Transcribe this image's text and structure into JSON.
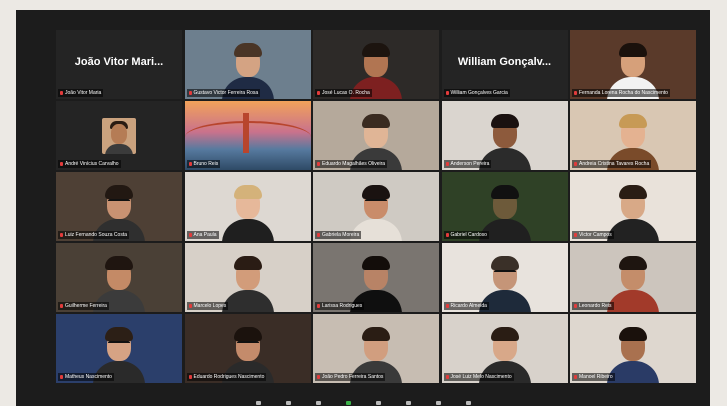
{
  "meeting": {
    "participants": [
      {
        "name": "João Vitor Maria",
        "display": "João Vitor Mari...",
        "video": false,
        "active": false
      },
      {
        "name": "Gustavo Victor Ferreira Rosa",
        "video": true,
        "active": true,
        "bg": "#6d7f8e",
        "skin": "#d4a383",
        "hair": "#4a3526",
        "shirt": "#1f2b44"
      },
      {
        "name": "José Lucas O. Rocha",
        "video": true,
        "bg": "#2d2a28",
        "skin": "#b17552",
        "hair": "#1c140f",
        "shirt": "#7d2020"
      },
      {
        "name": "William Gonçalves Garcia",
        "display": "William Gonçalv...",
        "video": false
      },
      {
        "name": "Fernanda Lorena Rocha do Nascimento",
        "video": true,
        "bg": "#5a3a2a",
        "skin": "#d6a07a",
        "hair": "#1a110c",
        "shirt": "#f2f2f2"
      },
      {
        "name": "André Vinícius Carvalho",
        "video": false,
        "avatar": true
      },
      {
        "name": "Bruno Reis",
        "video": true,
        "scenery": "bridge"
      },
      {
        "name": "Eduardo Magalhães Oliveira",
        "video": true,
        "bg": "#b5a99b",
        "skin": "#e0b596",
        "hair": "#3a2b20",
        "shirt": "#3a3a3a"
      },
      {
        "name": "Anderson Pereira",
        "video": true,
        "bg": "#dad5cf",
        "skin": "#8d5a3c",
        "hair": "#1a1110",
        "shirt": "#2b2b2b"
      },
      {
        "name": "Andreia Cristina Tavares Rocha",
        "video": true,
        "bg": "#d9c7b3",
        "skin": "#e4b291",
        "hair": "#c79a56",
        "shirt": "#7a4b2a"
      },
      {
        "name": "Luiz Fernando Souza Costa",
        "video": true,
        "bg": "#4e4035",
        "skin": "#c99272",
        "hair": "#221812",
        "shirt": "#2f2f2f",
        "glasses": true
      },
      {
        "name": "Ana Paula",
        "video": true,
        "bg": "#ddd8d2",
        "skin": "#e6b89a",
        "hair": "#d4b27a",
        "shirt": "#1f1f1f"
      },
      {
        "name": "Gabriela Moreira",
        "video": true,
        "bg": "#cfcac3",
        "skin": "#c98c6a",
        "hair": "#1a1210",
        "shirt": "#e6e0d8",
        "glasses": true
      },
      {
        "name": "Gabriel Cardoso",
        "video": true,
        "bg": "#2f4126",
        "skin": "#6d5a3a",
        "hair": "#111",
        "shirt": "#202020"
      },
      {
        "name": "Victor Campos",
        "video": true,
        "bg": "#e9e2da",
        "skin": "#d8a987",
        "hair": "#2a1d14",
        "shirt": "#222"
      },
      {
        "name": "Guilherme Ferreira",
        "video": true,
        "bg": "#4a4036",
        "skin": "#c48a66",
        "hair": "#1f1510",
        "shirt": "#3b3b3b"
      },
      {
        "name": "Marcelo Lopes",
        "video": true,
        "bg": "#d7d0c8",
        "skin": "#d29c7a",
        "hair": "#2a1c14",
        "shirt": "#2e2e2e"
      },
      {
        "name": "Larissa Rodrigues",
        "video": true,
        "bg": "#7a7570",
        "skin": "#b88366",
        "hair": "#130d0a",
        "shirt": "#0f0f0f"
      },
      {
        "name": "Ricardo Almeida",
        "video": true,
        "bg": "#e8e3dd",
        "skin": "#c59578",
        "hair": "#3a3028",
        "shirt": "#1e2a3a",
        "glasses": true
      },
      {
        "name": "Leonardo Reis",
        "video": true,
        "bg": "#ccc5bd",
        "skin": "#c48d6a",
        "hair": "#1e1510",
        "shirt": "#a23a2a"
      },
      {
        "name": "Matheus Nascimento",
        "video": true,
        "bg": "#2b3f6b",
        "skin": "#d6a384",
        "hair": "#2c1f16",
        "shirt": "#2a2a2a",
        "glasses": true
      },
      {
        "name": "Eduardo Rodrigues Nascimento",
        "video": true,
        "bg": "#3a2d26",
        "skin": "#c48b6b",
        "hair": "#1b120d",
        "shirt": "#2a2a2a",
        "glasses": true
      },
      {
        "name": "João Pedro Ferreira Santos",
        "video": true,
        "bg": "#c7bdb2",
        "skin": "#d19e7f",
        "hair": "#2a1d14",
        "shirt": "#3a3a3a"
      },
      {
        "name": "José Luiz Melo Nascimento",
        "video": true,
        "bg": "#d8d2cb",
        "skin": "#d8a889",
        "hair": "#2a1d14",
        "shirt": "#2a2a2a"
      },
      {
        "name": "Manoel Ribeiro",
        "video": true,
        "bg": "#ded7cf",
        "skin": "#a9714f",
        "hair": "#1a110c",
        "shirt": "#2a3b66"
      }
    ]
  }
}
